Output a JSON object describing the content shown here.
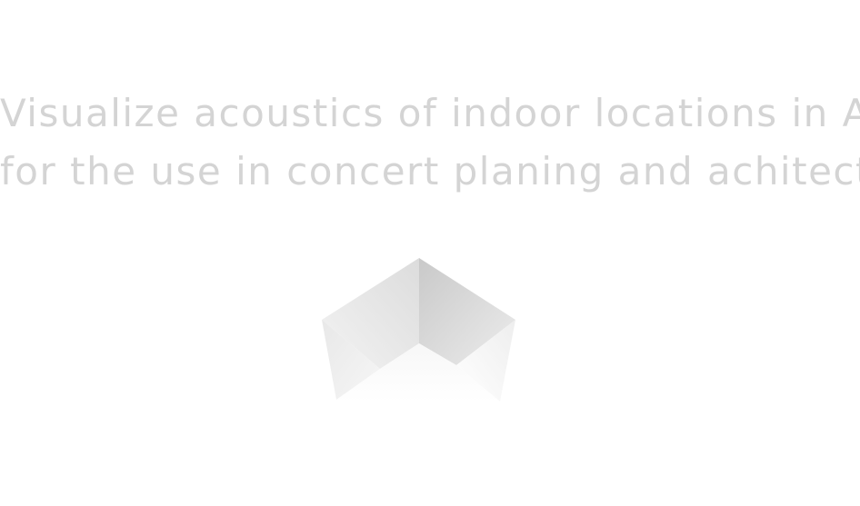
{
  "tagline": {
    "line1": "Visualize acoustics of indoor locations in AR",
    "line2": "for the use in concert planing and achitecture."
  },
  "logo": {
    "icon": "room-corner-icon",
    "colors": {
      "light": "#f4f4f4",
      "mid": "#e6e6e6",
      "dark": "#cfcfcf",
      "floor": "#fafafa"
    }
  }
}
